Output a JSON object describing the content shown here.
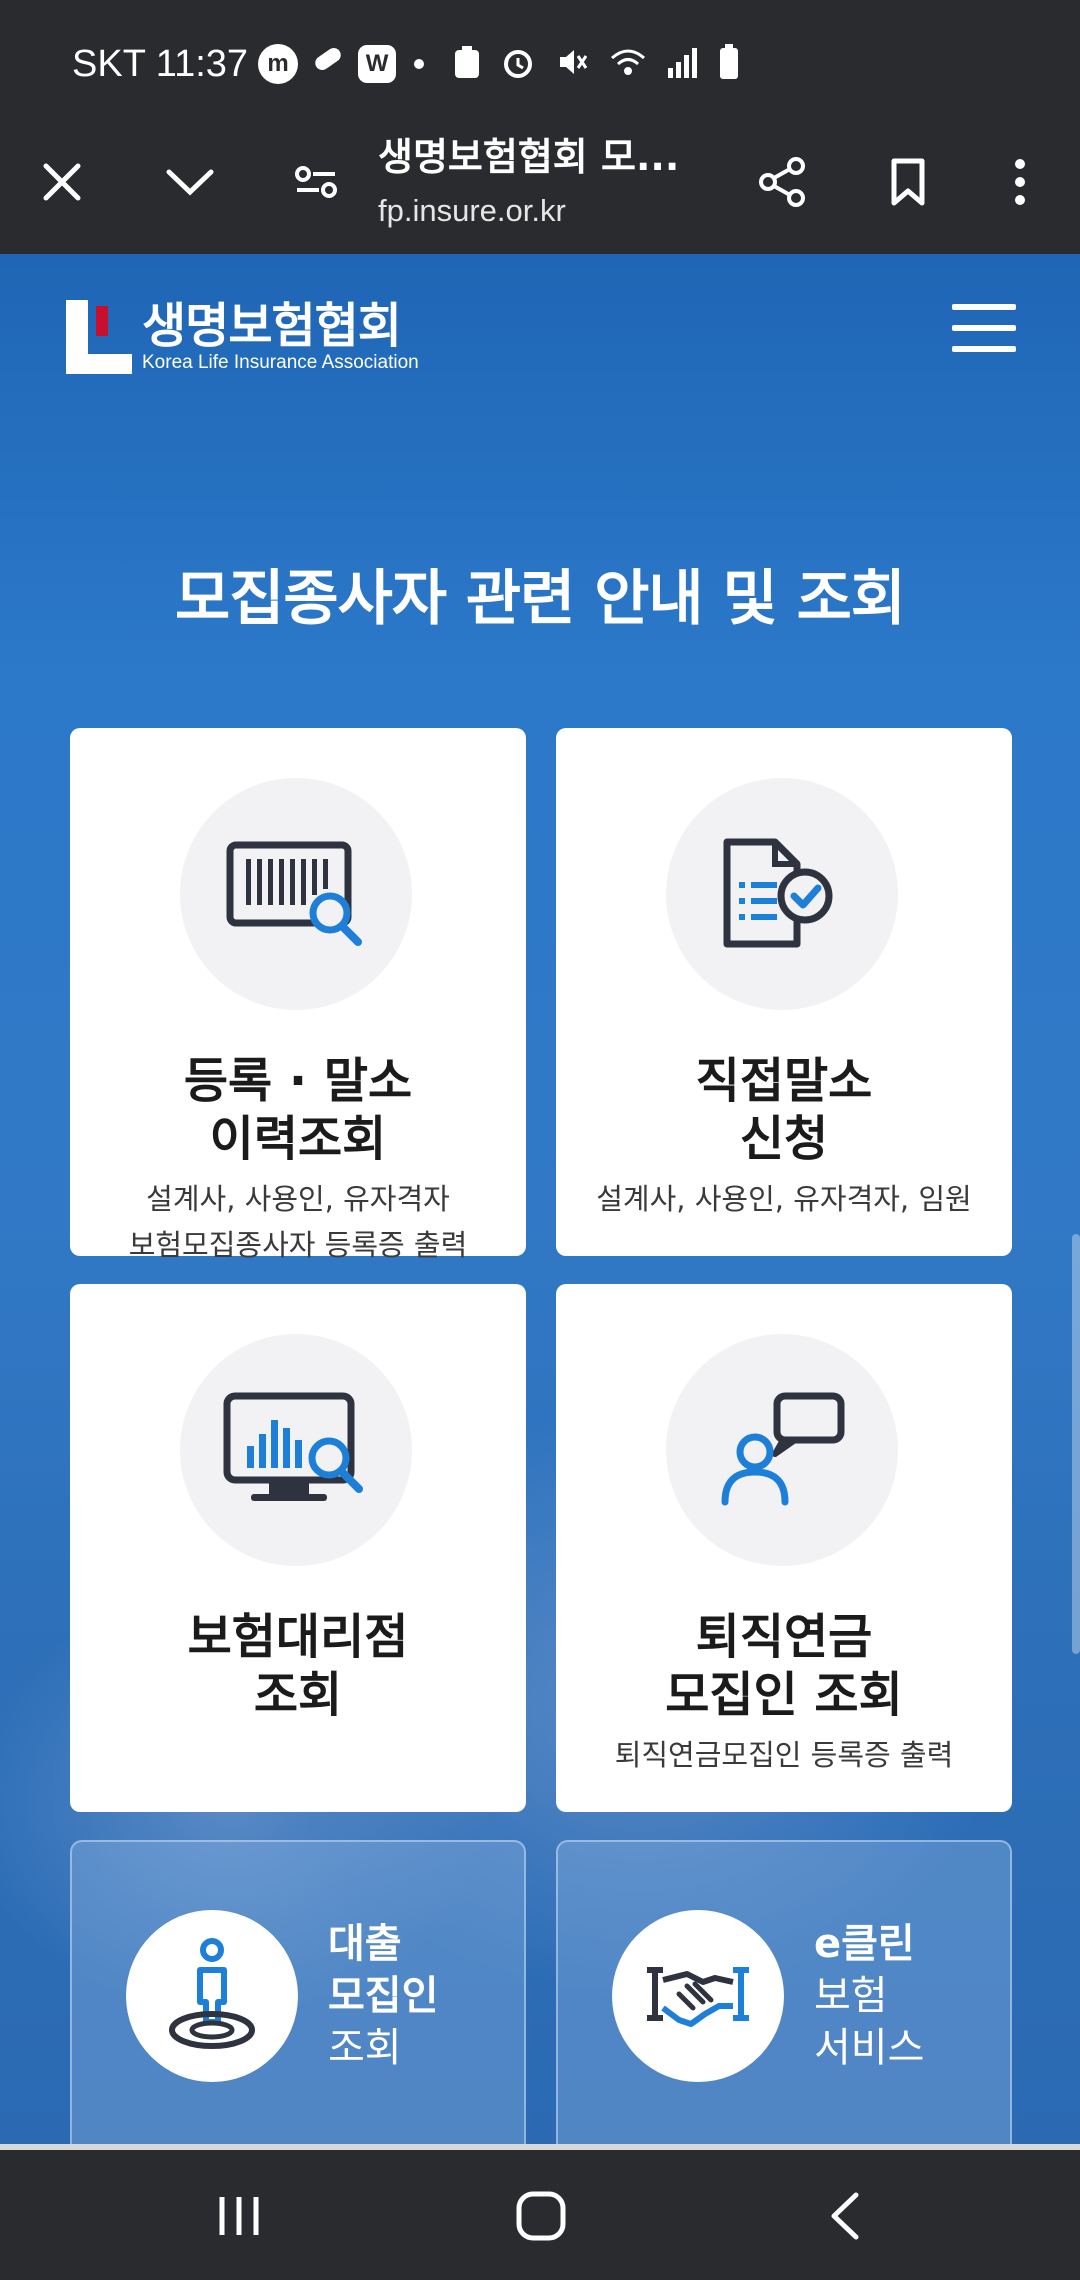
{
  "status_bar": {
    "carrier_time": "SKT 11:37",
    "badge_m": "m",
    "badge_w": "W"
  },
  "browser": {
    "title": "생명보험협회 모...",
    "url": "fp.insure.or.kr"
  },
  "header": {
    "logo_ko": "생명보험협회",
    "logo_en": "Korea Life Insurance Association"
  },
  "section": {
    "title_light": "모집종사자 ",
    "title_bold": "관련 안내 및 조회"
  },
  "cards": [
    {
      "title_line1": "등록 · 말소",
      "title_line2": "이력조회",
      "sub_line1": "설계사, 사용인, 유자격자",
      "sub_line2": "보험모집종사자 등록증 출력",
      "icon": "barcode-search-icon"
    },
    {
      "title_line1": "직접말소",
      "title_line2": "신청",
      "sub_line1": "설계사, 사용인, 유자격자, 임원",
      "icon": "document-check-icon"
    },
    {
      "title_line1": "보험대리점",
      "title_line2": "조회",
      "icon": "monitor-chart-search-icon"
    },
    {
      "title_line1": "퇴직연금",
      "title_line2": "모집인 조회",
      "sub_line1": "퇴직연금모집인 등록증 출력",
      "icon": "person-chat-icon"
    }
  ],
  "mini_cards": [
    {
      "line1": "대출",
      "line2": "모집인",
      "line3": "조회",
      "icon": "person-location-icon"
    },
    {
      "line1": "e클린",
      "line2": "보험",
      "line3": "서비스",
      "icon": "handshake-icon"
    }
  ],
  "colors": {
    "chrome": "#2a2b2e",
    "page_blue": "#2c78c9",
    "icon_dark": "#2f3340",
    "icon_blue": "#1e7fd8",
    "logo_red": "#c8102e"
  }
}
